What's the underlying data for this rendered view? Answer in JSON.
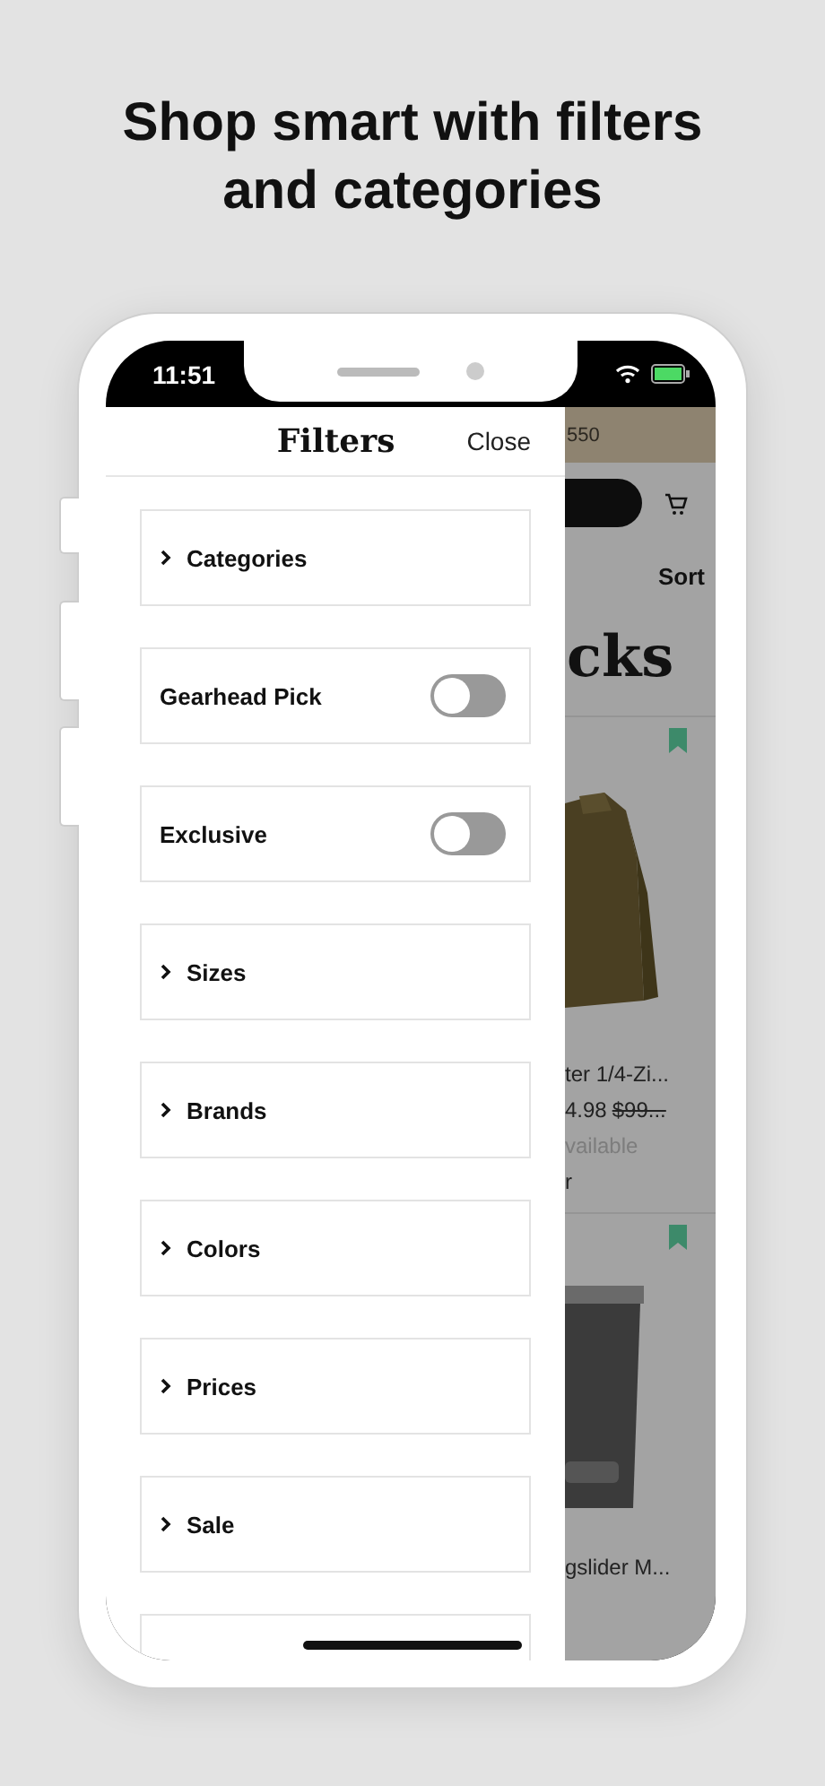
{
  "headline": "Shop smart with filters and categories",
  "status_bar": {
    "time": "11:51"
  },
  "filters_panel": {
    "title": "Filters",
    "close": "Close",
    "items": [
      {
        "kind": "expandable",
        "label": "Categories",
        "expanded": false
      },
      {
        "kind": "toggle",
        "label": "Gearhead Pick",
        "on": false
      },
      {
        "kind": "toggle",
        "label": "Exclusive",
        "on": false
      },
      {
        "kind": "expandable",
        "label": "Sizes",
        "expanded": false
      },
      {
        "kind": "expandable",
        "label": "Brands",
        "expanded": false
      },
      {
        "kind": "expandable",
        "label": "Colors",
        "expanded": false
      },
      {
        "kind": "expandable",
        "label": "Prices",
        "expanded": false
      },
      {
        "kind": "expandable",
        "label": "Sale",
        "expanded": false
      }
    ]
  },
  "background_page": {
    "banner": "550",
    "sort": "Sort",
    "heading": "cks",
    "products": [
      {
        "name": "ter 1/4-Zi...",
        "price": "4.98",
        "old_price": "$99...",
        "availability": "vailable",
        "note": "r",
        "kind": "jacket"
      },
      {
        "name": "gslider M...",
        "kind": "tumbler"
      }
    ]
  }
}
